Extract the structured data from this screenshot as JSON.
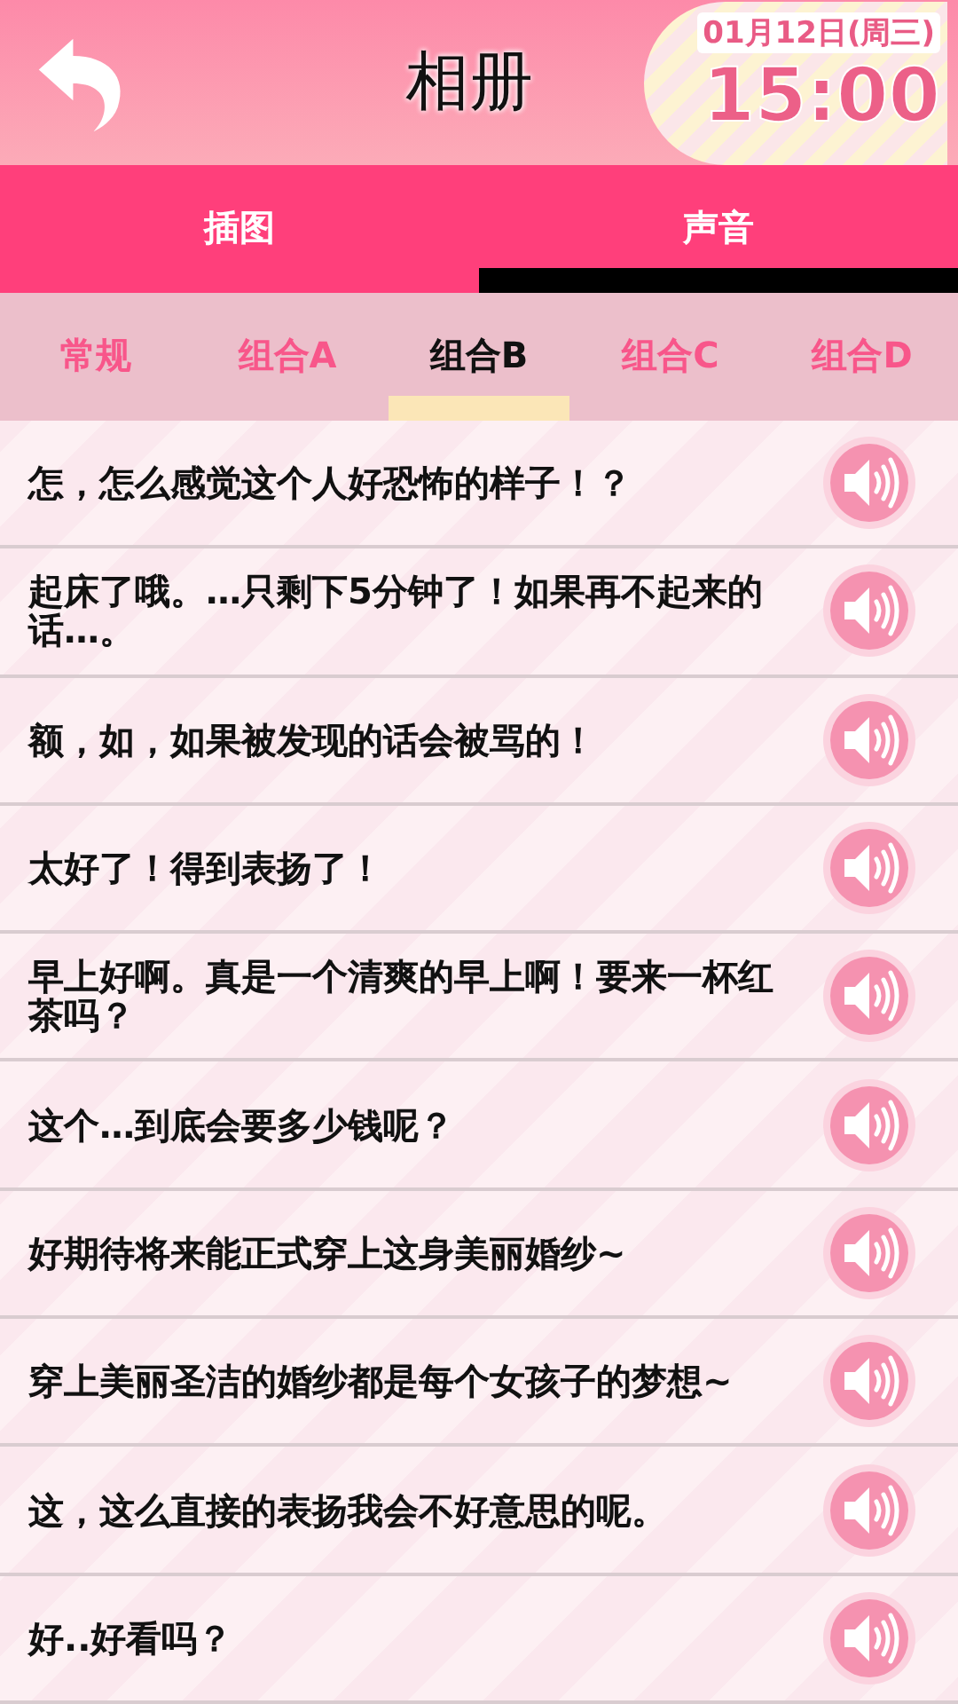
{
  "header": {
    "title": "相册",
    "date": "01月12日(周三)",
    "time": "15:00"
  },
  "tabs": [
    {
      "label": "插图",
      "selected": false
    },
    {
      "label": "声音",
      "selected": true
    }
  ],
  "subtabs": [
    {
      "label": "常规",
      "selected": false
    },
    {
      "label": "组合A",
      "selected": false
    },
    {
      "label": "组合B",
      "selected": true
    },
    {
      "label": "组合C",
      "selected": false
    },
    {
      "label": "组合D",
      "selected": false
    }
  ],
  "voices": [
    {
      "text": "怎，怎么感觉这个人好恐怖的样子！？"
    },
    {
      "text": "起床了哦。…只剩下5分钟了！如果再不起来的话…。"
    },
    {
      "text": "额，如，如果被发现的话会被骂的！"
    },
    {
      "text": "太好了！得到表扬了！"
    },
    {
      "text": "早上好啊。真是一个清爽的早上啊！要来一杯红茶吗？"
    },
    {
      "text": "这个…到底会要多少钱呢？"
    },
    {
      "text": "好期待将来能正式穿上这身美丽婚纱~"
    },
    {
      "text": "穿上美丽圣洁的婚纱都是每个女孩子的梦想~"
    },
    {
      "text": "这，这么直接的表扬我会不好意思的呢。"
    },
    {
      "text": "好..好看吗？"
    }
  ]
}
